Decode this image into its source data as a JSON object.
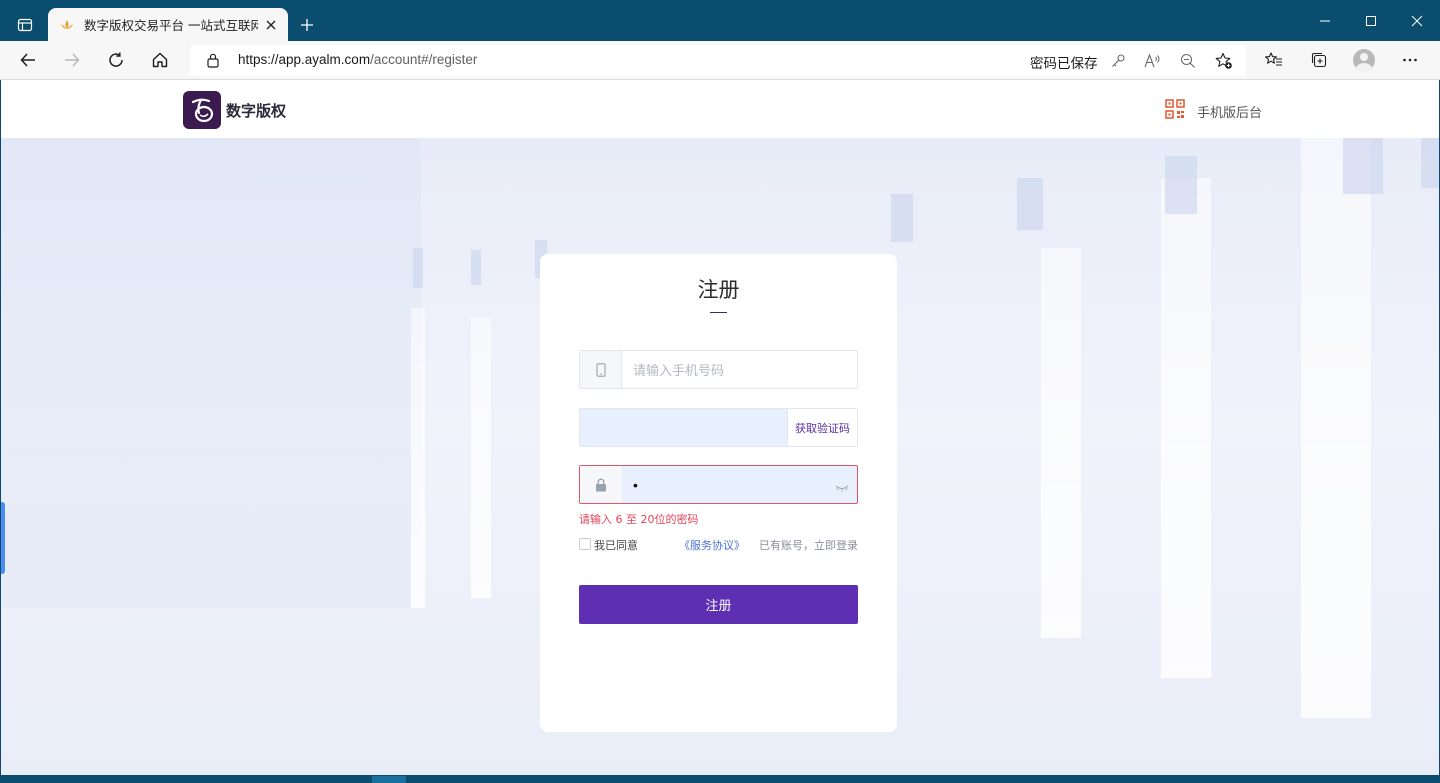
{
  "browser": {
    "tab_title": "数字版权交易平台 一站式互联网",
    "url_host": "https://app.ayalm.com",
    "url_path": "/account#/register",
    "password_saved": "密码已保存"
  },
  "header": {
    "brand": "数字版权",
    "mobile_admin": "手机版后台"
  },
  "register": {
    "title": "注册",
    "phone_placeholder": "请输入手机号码",
    "code_value": "",
    "get_code": "获取验证码",
    "password_value": "•",
    "password_error": "请输入 6 至 20位的密码",
    "agree_prefix": "我已同意",
    "agreement_link": "《服务协议》",
    "login_link": "已有账号，立即登录",
    "submit": "注册"
  },
  "colors": {
    "primary": "#5f2fb3",
    "error": "#e0445a",
    "link": "#4a74d8",
    "autofill": "#e8f0fe",
    "titlebar": "#0b4d6f"
  },
  "icons": {
    "tab_actions": "tab-actions-icon",
    "favicon": "lotus-favicon-icon",
    "close": "close-icon",
    "new_tab": "plus-icon",
    "back": "back-arrow-icon",
    "forward": "forward-arrow-icon",
    "refresh": "refresh-icon",
    "home": "home-icon",
    "lock": "lock-icon",
    "key": "key-icon",
    "read_aloud": "read-aloud-icon",
    "zoom": "zoom-out-icon",
    "favorite": "add-favorite-icon",
    "favorites": "favorites-icon",
    "collections": "collections-icon",
    "profile": "profile-icon",
    "more": "more-icon",
    "qr": "qr-code-icon",
    "phone": "phone-icon",
    "padlock": "padlock-icon",
    "eye": "eye-closed-icon"
  }
}
